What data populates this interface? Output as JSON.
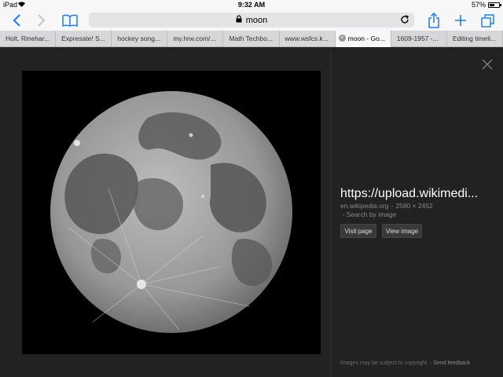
{
  "status": {
    "carrier": "iPad",
    "time": "9:32 AM",
    "battery_text": "57%",
    "battery_level": 0.57
  },
  "toolbar": {
    "url_text": "moon",
    "accent_color": "#1a7cf6"
  },
  "tabs": [
    {
      "label": "Holt, Rinehar..."
    },
    {
      "label": "Expresate! S..."
    },
    {
      "label": "hockey song..."
    },
    {
      "label": "my.hrw.com/..."
    },
    {
      "label": "Math Techbo..."
    },
    {
      "label": "www.wsfcs.k..."
    },
    {
      "label": "moon - Go...",
      "active": true
    },
    {
      "label": "1609-1957 -..."
    },
    {
      "label": "Editing timeli..."
    }
  ],
  "result": {
    "title": "https://upload.wikimedi...",
    "domain": "en.wikipedia.org",
    "dimensions": "2580 × 2452",
    "search_by_image": "Search by image",
    "visit_page": "Visit page",
    "view_image": "View image"
  },
  "footer": {
    "copyright": "Images may be subject to copyright.",
    "send_feedback": "Send feedback"
  }
}
